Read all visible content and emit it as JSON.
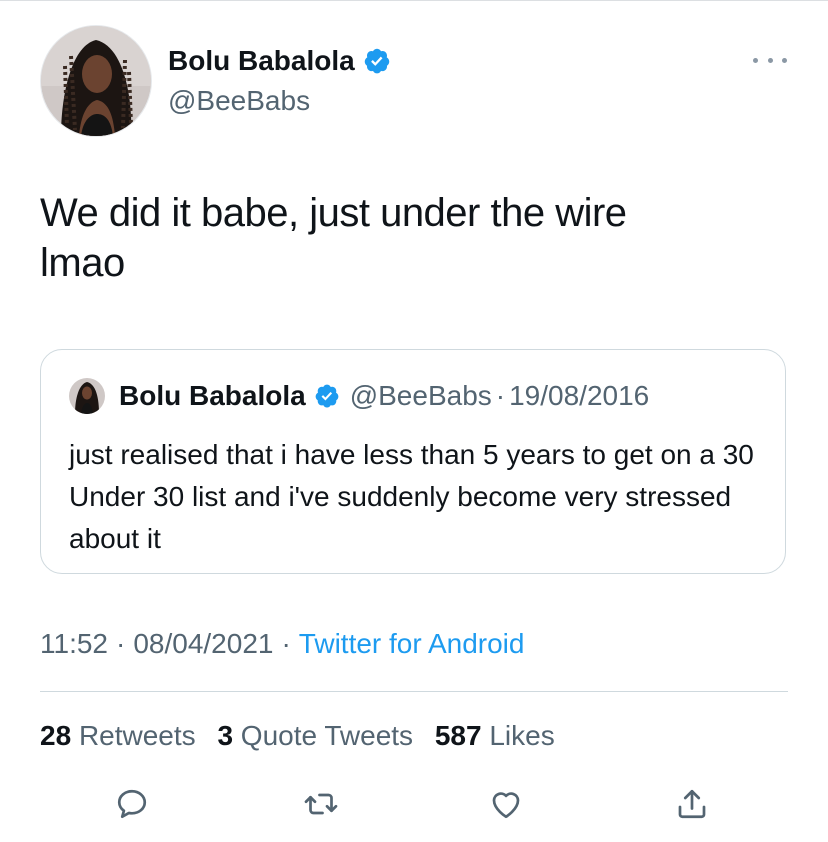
{
  "tweet": {
    "author": {
      "name": "Bolu Babalola",
      "handle": "@BeeBabs",
      "verified": true
    },
    "text_line1": "We did it babe, just under the wire",
    "text_line2": "lmao",
    "timestamp_time": "11:52",
    "timestamp_date": "08/04/2021",
    "source": "Twitter for Android",
    "separator": "·"
  },
  "quoted_tweet": {
    "name": "Bolu Babalola",
    "handle": "@BeeBabs",
    "separator": "·",
    "date": "19/08/2016",
    "text": "just realised that i have less than 5 years to get on a 30 Under 30 list and i've suddenly become very stressed about it"
  },
  "stats": {
    "retweets_count": "28",
    "retweets_label": "Retweets",
    "quotes_count": "3",
    "quotes_label": "Quote Tweets",
    "likes_count": "587",
    "likes_label": "Likes"
  },
  "actions": [
    "reply-icon",
    "retweet-icon",
    "like-icon",
    "share-icon"
  ],
  "colors": {
    "accent": "#1d9bf0",
    "secondary_text": "#536471",
    "primary_text": "#0f1419",
    "border": "#cfd9de"
  }
}
